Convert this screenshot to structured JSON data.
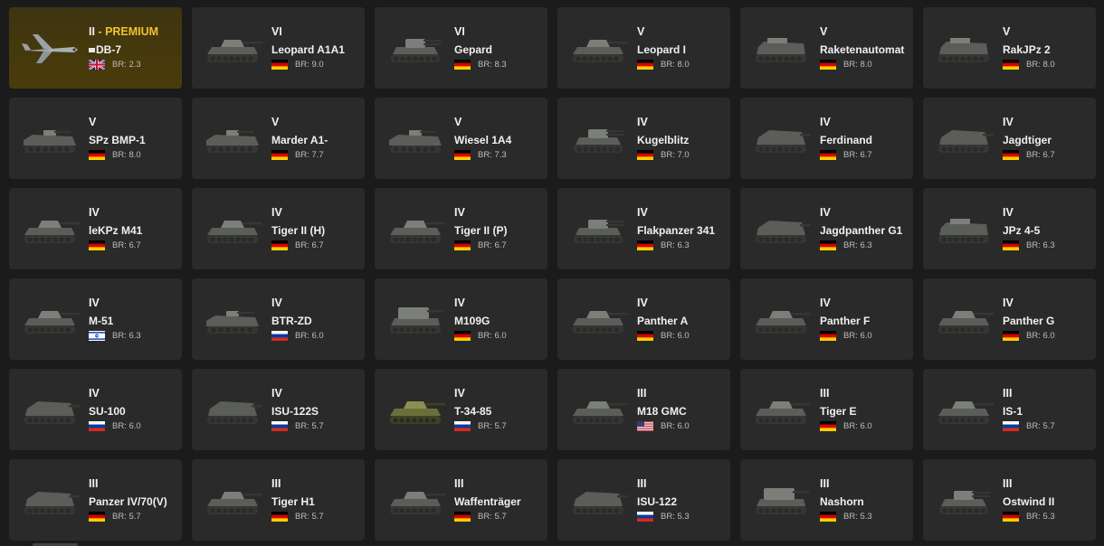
{
  "premium_label": "PREMIUM",
  "br_prefix": "BR:",
  "vehicles": [
    {
      "rank": "II",
      "premium": true,
      "name": "DB-7",
      "nation": "gb",
      "br": "2.3",
      "type": "plane"
    },
    {
      "rank": "VI",
      "name": "Leopard A1A1",
      "nation": "de",
      "br": "9.0",
      "type": "tank"
    },
    {
      "rank": "VI",
      "name": "Gepard",
      "nation": "de",
      "br": "8.3",
      "type": "spaa"
    },
    {
      "rank": "V",
      "name": "Leopard I",
      "nation": "de",
      "br": "8.0",
      "type": "tank"
    },
    {
      "rank": "V",
      "name": "Raketenautomat",
      "nation": "de",
      "br": "8.0",
      "type": "boxy"
    },
    {
      "rank": "V",
      "name": "RakJPz 2",
      "nation": "de",
      "br": "8.0",
      "type": "boxy"
    },
    {
      "rank": "V",
      "name": "SPz BMP-1",
      "nation": "de",
      "br": "8.0",
      "type": "ifv"
    },
    {
      "rank": "V",
      "name": "Marder A1-",
      "nation": "de",
      "br": "7.7",
      "type": "ifv"
    },
    {
      "rank": "V",
      "name": "Wiesel 1A4",
      "nation": "de",
      "br": "7.3",
      "type": "ifv"
    },
    {
      "rank": "IV",
      "name": "Kugelblitz",
      "nation": "de",
      "br": "7.0",
      "type": "spaa"
    },
    {
      "rank": "IV",
      "name": "Ferdinand",
      "nation": "de",
      "br": "6.7",
      "type": "td"
    },
    {
      "rank": "IV",
      "name": "Jagdtiger",
      "nation": "de",
      "br": "6.7",
      "type": "td"
    },
    {
      "rank": "IV",
      "name": "leKPz M41",
      "nation": "de",
      "br": "6.7",
      "type": "tank"
    },
    {
      "rank": "IV",
      "name": "Tiger II (H)",
      "nation": "de",
      "br": "6.7",
      "type": "tank"
    },
    {
      "rank": "IV",
      "name": "Tiger II (P)",
      "nation": "de",
      "br": "6.7",
      "type": "tank"
    },
    {
      "rank": "IV",
      "name": "Flakpanzer 341",
      "nation": "de",
      "br": "6.3",
      "type": "spaa"
    },
    {
      "rank": "IV",
      "name": "Jagdpanther G1",
      "nation": "de",
      "br": "6.3",
      "type": "td"
    },
    {
      "rank": "IV",
      "name": "JPz 4-5",
      "nation": "de",
      "br": "6.3",
      "type": "boxy"
    },
    {
      "rank": "IV",
      "name": "M-51",
      "nation": "il",
      "br": "6.3",
      "type": "tank"
    },
    {
      "rank": "IV",
      "name": "BTR-ZD",
      "nation": "ru",
      "br": "6.0",
      "type": "ifv"
    },
    {
      "rank": "IV",
      "name": "M109G",
      "nation": "de",
      "br": "6.0",
      "type": "spg"
    },
    {
      "rank": "IV",
      "name": "Panther A",
      "nation": "de",
      "br": "6.0",
      "type": "tank"
    },
    {
      "rank": "IV",
      "name": "Panther F",
      "nation": "de",
      "br": "6.0",
      "type": "tank"
    },
    {
      "rank": "IV",
      "name": "Panther G",
      "nation": "de",
      "br": "6.0",
      "type": "tank"
    },
    {
      "rank": "IV",
      "name": "SU-100",
      "nation": "ru",
      "br": "6.0",
      "type": "td"
    },
    {
      "rank": "IV",
      "name": "ISU-122S",
      "nation": "ru",
      "br": "5.7",
      "type": "td"
    },
    {
      "rank": "IV",
      "name": "T-34-85",
      "nation": "ru",
      "br": "5.7",
      "type": "tank",
      "green": true
    },
    {
      "rank": "III",
      "name": "M18 GMC",
      "nation": "us",
      "br": "6.0",
      "type": "tank"
    },
    {
      "rank": "III",
      "name": "Tiger E",
      "nation": "de",
      "br": "6.0",
      "type": "tank"
    },
    {
      "rank": "III",
      "name": "IS-1",
      "nation": "ru",
      "br": "5.7",
      "type": "tank"
    },
    {
      "rank": "III",
      "name": "Panzer IV/70(V)",
      "nation": "de",
      "br": "5.7",
      "type": "td"
    },
    {
      "rank": "III",
      "name": "Tiger H1",
      "nation": "de",
      "br": "5.7",
      "type": "tank"
    },
    {
      "rank": "III",
      "name": "Waffenträger",
      "nation": "de",
      "br": "5.7",
      "type": "tank"
    },
    {
      "rank": "III",
      "name": "ISU-122",
      "nation": "ru",
      "br": "5.3",
      "type": "td"
    },
    {
      "rank": "III",
      "name": "Nashorn",
      "nation": "de",
      "br": "5.3",
      "type": "spg"
    },
    {
      "rank": "III",
      "name": "Ostwind II",
      "nation": "de",
      "br": "5.3",
      "type": "spaa"
    }
  ],
  "colors": {
    "premium": "#f2c12e",
    "card": "#2a2a2a",
    "background": "#1b1b1b"
  }
}
